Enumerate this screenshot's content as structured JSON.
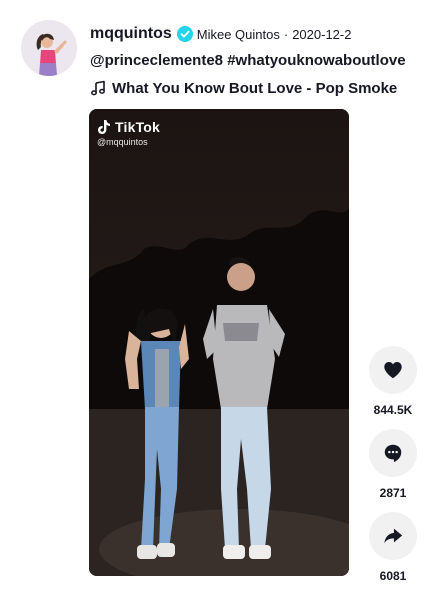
{
  "author": {
    "username": "mqquintos",
    "nickname": "Mikee Quintos",
    "separator": "·",
    "date": "2020-12-2"
  },
  "caption": {
    "mention": "@princeclemente8",
    "hashtag": "#whatyouknowaboutlove"
  },
  "music": {
    "title": "What You Know Bout Love - Pop Smoke",
    "icon": "music-note-icon"
  },
  "video": {
    "watermark_brand": "TikTok",
    "watermark_handle": "@mqquintos"
  },
  "actions": {
    "likes": "844.5K",
    "comments": "2871",
    "shares": "6081"
  },
  "colors": {
    "verified": "#20d5ec",
    "action_bg": "#f1f1f2",
    "text": "#161823"
  }
}
